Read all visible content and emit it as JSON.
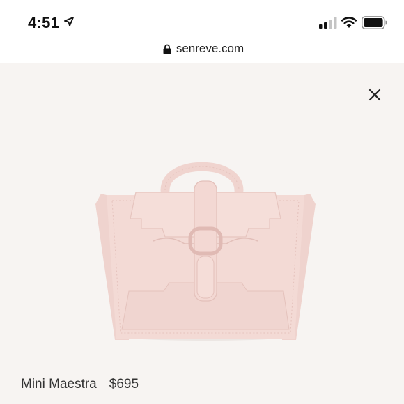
{
  "status_bar": {
    "time": "4:51",
    "location_icon": "location-arrow-icon",
    "signal_icon": "cellular-signal-icon",
    "wifi_icon": "wifi-icon",
    "battery_icon": "battery-icon"
  },
  "browser": {
    "url": "senreve.com",
    "lock_icon": "lock-icon"
  },
  "modal": {
    "close_icon": "close-icon"
  },
  "product": {
    "name": "Mini Maestra",
    "price": "$695",
    "image": "handbag-image",
    "color": "#f2d6d1"
  }
}
